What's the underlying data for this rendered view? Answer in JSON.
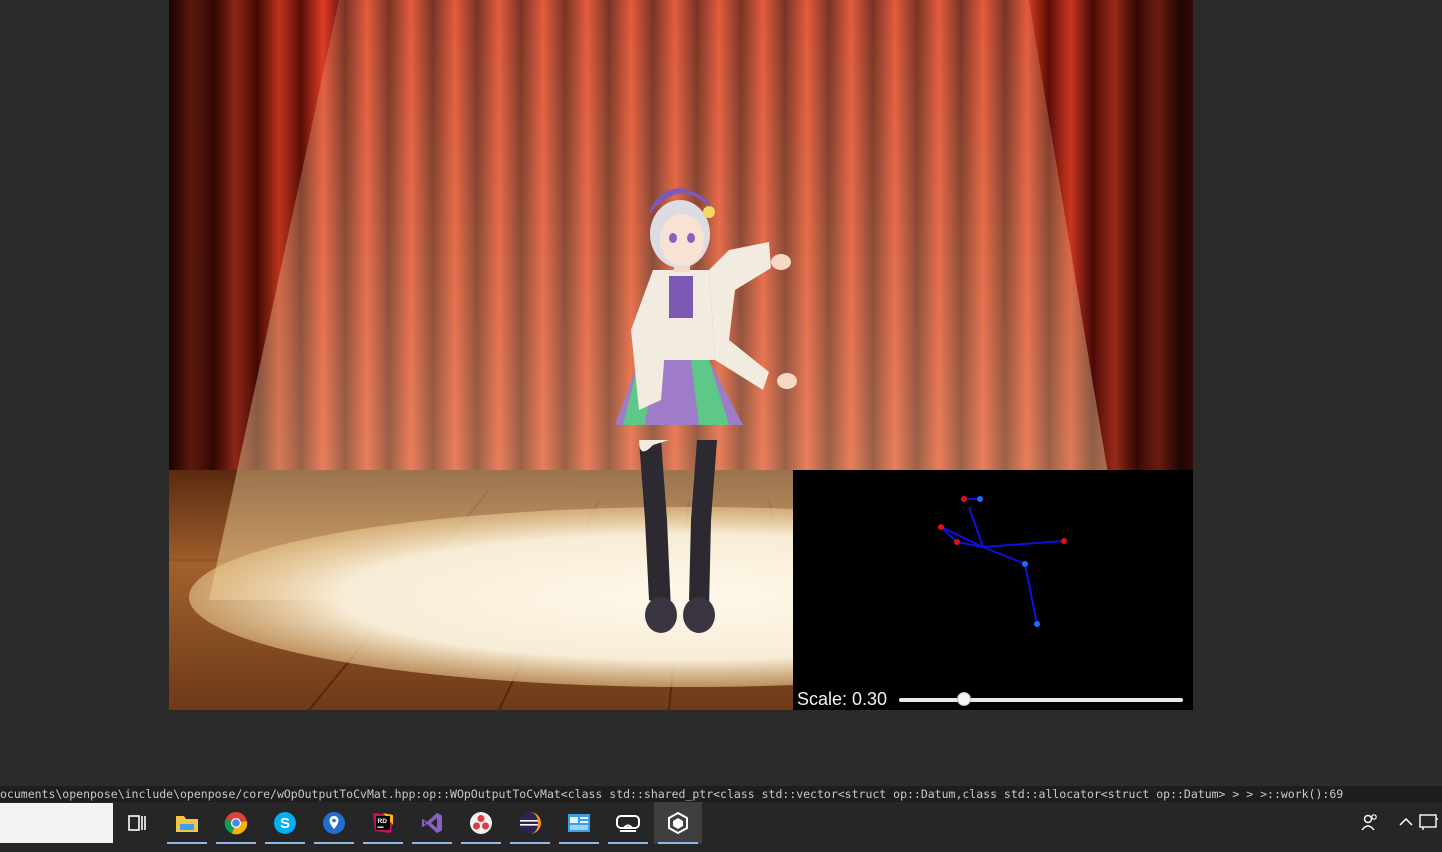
{
  "overlay": {
    "scale_label": "Scale: 0.30",
    "scale_value": 0.3,
    "slider_fraction": 0.23
  },
  "console": {
    "text": "ocuments\\openpose\\include\\openpose/core/wOpOutputToCvMat.hpp:op::WOpOutputToCvMat<class std::shared_ptr<class std::vector<struct op::Datum,class std::allocator<struct op::Datum> > > >::work():69"
  },
  "taskbar": {
    "search_value": "",
    "apps": [
      {
        "icon": "task-view-icon",
        "running": false,
        "active": false
      },
      {
        "icon": "file-explorer-icon",
        "running": true,
        "active": false
      },
      {
        "icon": "chrome-icon",
        "running": true,
        "active": false
      },
      {
        "icon": "skype-icon",
        "running": true,
        "active": false
      },
      {
        "icon": "maps-pin-icon",
        "running": true,
        "active": false
      },
      {
        "icon": "rider-icon",
        "running": true,
        "active": false
      },
      {
        "icon": "visual-studio-icon",
        "running": true,
        "active": false
      },
      {
        "icon": "davinci-icon",
        "running": true,
        "active": false
      },
      {
        "icon": "eclipse-icon",
        "running": true,
        "active": false
      },
      {
        "icon": "control-panel-icon",
        "running": true,
        "active": false
      },
      {
        "icon": "vr-headset-icon",
        "running": true,
        "active": false
      },
      {
        "icon": "unity-icon",
        "running": true,
        "active": true
      }
    ],
    "tray": [
      "people-icon",
      "chevron-up-icon",
      "action-center-icon"
    ]
  },
  "colors": {
    "background": "#2b2b2b",
    "taskbar": "#262626",
    "pose_line": "#1010e0",
    "pose_point_red": "#e01010",
    "pose_point_blue": "#1e6ef0",
    "accent_underline": "#8fb8e8"
  }
}
